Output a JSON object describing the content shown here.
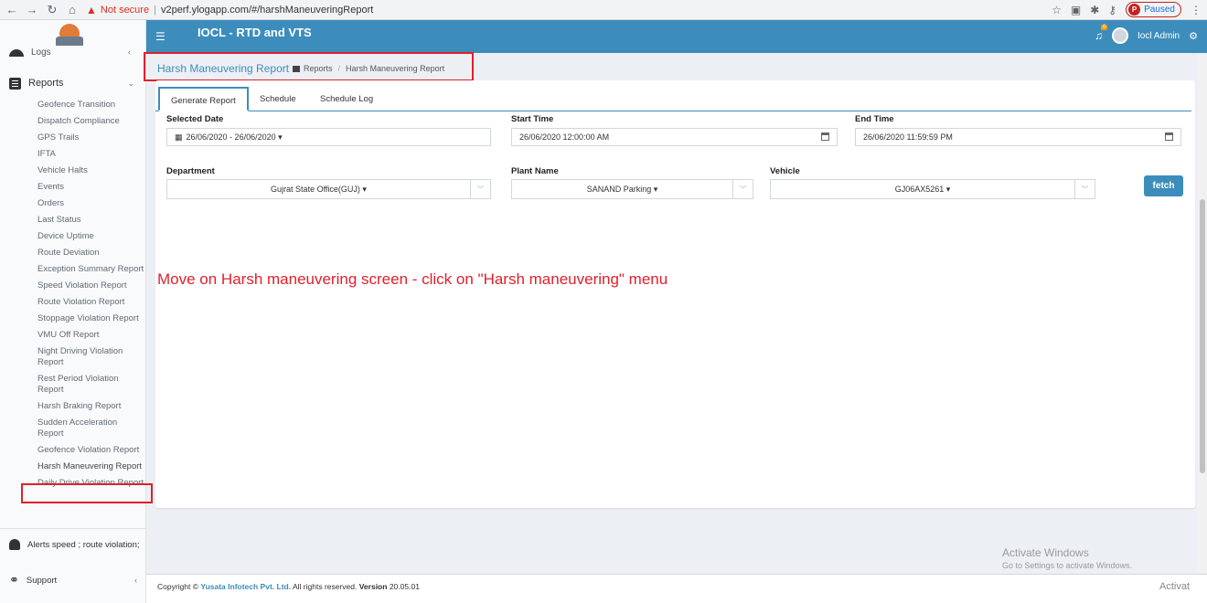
{
  "browser": {
    "security_label": "Not secure",
    "url": "v2perf.ylogapp.com/#/harshManeuveringReport",
    "profile_initial": "P",
    "profile_status": "Paused"
  },
  "header": {
    "app_title": "IOCL - RTD and VTS",
    "notification_count": "0",
    "user_name": "Iocl Admin"
  },
  "sidebar": {
    "logs_label": "Logs",
    "reports_label": "Reports",
    "report_items": [
      "Geofence Transition",
      "Dispatch Compliance",
      "GPS Trails",
      "IFTA",
      "Vehicle Halts",
      "Events",
      "Orders",
      "Last Status",
      "Device Uptime",
      "Route Deviation",
      "Exception Summary Report",
      "Speed Violation Report",
      "Route Violation Report",
      "Stoppage Violation Report",
      "VMU Off Report",
      "Night Driving Violation Report",
      "Rest Period Violation Report",
      "Harsh Braking Report",
      "Sudden Acceleration Report",
      "Geofence Violation Report",
      "Harsh Maneuvering Report",
      "Daily Drive Violation Report"
    ],
    "alerts_label": "Alerts speed ; route violation;",
    "support_label": "Support"
  },
  "breadcrumb": {
    "title": "Harsh Maneuvering Report",
    "reports": "Reports",
    "current": "Harsh Maneuvering Report"
  },
  "tabs": [
    "Generate Report",
    "Schedule",
    "Schedule Log"
  ],
  "form": {
    "selected_date_label": "Selected Date",
    "selected_date_value": "26/06/2020 - 26/06/2020 ▾",
    "start_time_label": "Start Time",
    "start_time_value": "26/06/2020 12:00:00 AM",
    "end_time_label": "End Time",
    "end_time_value": "26/06/2020 11:59:59 PM",
    "department_label": "Department",
    "department_value": "Gujrat State Office(GUJ) ▾",
    "plant_label": "Plant Name",
    "plant_value": "SANAND Parking ▾",
    "vehicle_label": "Vehicle",
    "vehicle_value": "GJ06AX5261 ▾",
    "fetch_label": "fetch"
  },
  "annotation": "Move on Harsh maneuvering screen - click on \"Harsh maneuvering\" menu",
  "footer": {
    "prefix": "Copyright © ",
    "company": "Yusata Infotech Pvt. Ltd.",
    "rights": " All rights reserved. ",
    "version_label": "Version",
    "version": "20.05.01"
  },
  "watermark": {
    "title": "Activate Windows",
    "subtitle": "Go to Settings to activate Windows.",
    "corner": "Activat"
  },
  "colors": {
    "accent": "#3c8dbc",
    "highlight": "#e0202a"
  }
}
